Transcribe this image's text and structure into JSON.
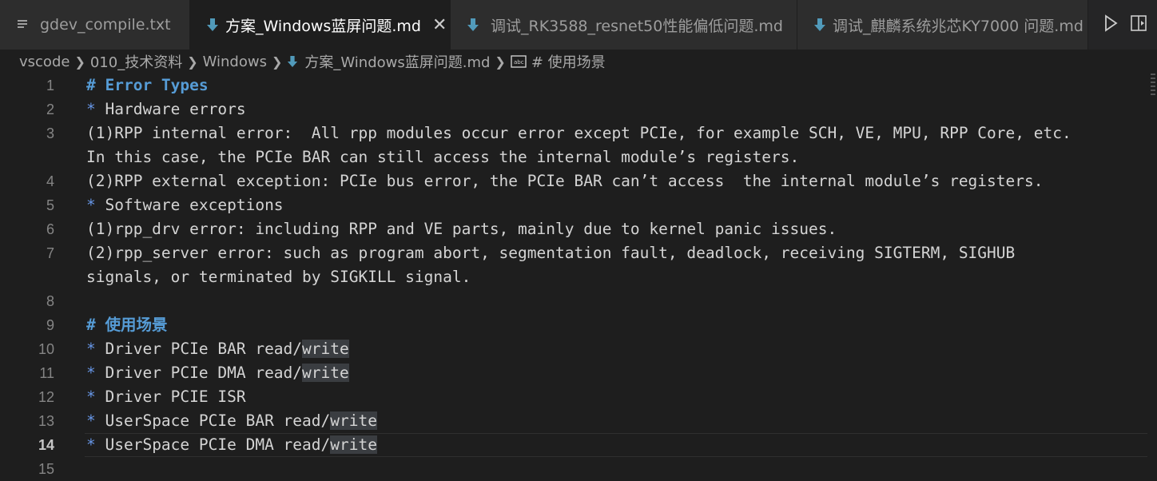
{
  "tabs": [
    {
      "label": "gdev_compile.txt",
      "icon": "lines-icon",
      "active": false
    },
    {
      "label": "方案_Windows蓝屏问题.md",
      "icon": "markdown-down-arrow-icon",
      "active": true
    },
    {
      "label": "调试_RK3588_resnet50性能偏低问题.md",
      "icon": "markdown-down-arrow-icon",
      "active": false
    },
    {
      "label": "调试_麒麟系统兆芯KY7000 问题.md",
      "icon": "markdown-down-arrow-icon",
      "active": false
    }
  ],
  "breadcrumb": [
    "vscode",
    "010_技术资料",
    "Windows",
    "方案_Windows蓝屏问题.md",
    "# 使用场景"
  ],
  "lines": [
    {
      "n": "1",
      "type": "heading",
      "text": "# Error Types"
    },
    {
      "n": "2",
      "type": "bullet",
      "marker": "*",
      "text": " Hardware errors"
    },
    {
      "n": "3",
      "type": "plain",
      "text": "(1)RPP internal error:  All rpp modules occur error except PCIe, for example SCH, VE, MPU, RPP Core, etc."
    },
    {
      "n": "",
      "type": "plain",
      "text": "In this case, the PCIe BAR can still access the internal module’s registers."
    },
    {
      "n": "4",
      "type": "plain",
      "text": "(2)RPP external exception: PCIe bus error, the PCIe BAR can’t access  the internal module’s registers."
    },
    {
      "n": "5",
      "type": "bullet",
      "marker": "*",
      "text": " Software exceptions"
    },
    {
      "n": "6",
      "type": "plain",
      "text": "(1)rpp_drv error: including RPP and VE parts, mainly due to kernel panic issues."
    },
    {
      "n": "7",
      "type": "plain",
      "text": "(2)rpp_server error: such as program abort, segmentation fault, deadlock, receiving SIGTERM, SIGHUB"
    },
    {
      "n": "",
      "type": "plain",
      "text": "signals, or terminated by SIGKILL signal."
    },
    {
      "n": "8",
      "type": "plain",
      "text": ""
    },
    {
      "n": "9",
      "type": "heading",
      "text": "# 使用场景"
    },
    {
      "n": "10",
      "type": "bullet-hl",
      "marker": "*",
      "text": " Driver PCIe BAR read/",
      "hl": "write"
    },
    {
      "n": "11",
      "type": "bullet-hl",
      "marker": "*",
      "text": " Driver PCIe DMA read/",
      "hl": "write"
    },
    {
      "n": "12",
      "type": "bullet",
      "marker": "*",
      "text": " Driver PCIE ISR"
    },
    {
      "n": "13",
      "type": "bullet-hl",
      "marker": "*",
      "text": " UserSpace PCIe BAR read/",
      "hl": "write"
    },
    {
      "n": "14",
      "type": "bullet-hl",
      "marker": "*",
      "text": " UserSpace PCIe DMA read/",
      "hl": "write",
      "current": true
    },
    {
      "n": "15",
      "type": "plain",
      "text": ""
    }
  ],
  "colors": {
    "accent": "#3c8dd9",
    "heading": "#569cd6",
    "editor_bg": "#1e1e1e"
  }
}
